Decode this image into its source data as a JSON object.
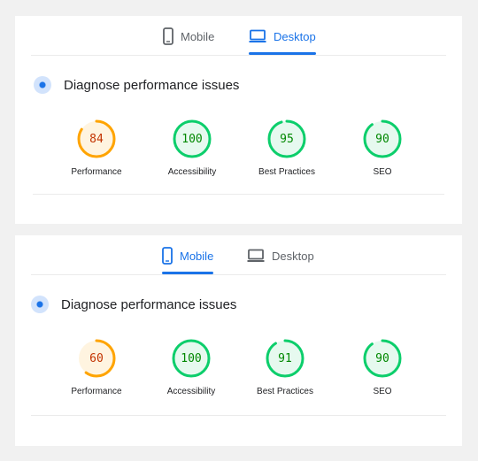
{
  "colors": {
    "accent": "#1a73e8",
    "pass": "#0cce6b",
    "average": "#ffa400",
    "pass_text": "#008800",
    "average_text": "#c33300"
  },
  "panels": [
    {
      "active_tab": "desktop",
      "tabs": {
        "mobile": {
          "label": "Mobile",
          "icon": "phone-icon"
        },
        "desktop": {
          "label": "Desktop",
          "icon": "laptop-icon"
        }
      },
      "diagnose": {
        "label": "Diagnose performance issues",
        "icon": "diagnose-icon"
      },
      "scores": [
        {
          "value": "84",
          "score": 84,
          "rating": "average",
          "label": "Performance"
        },
        {
          "value": "100",
          "score": 100,
          "rating": "pass",
          "label": "Accessibility"
        },
        {
          "value": "95",
          "score": 95,
          "rating": "pass",
          "label": "Best Practices"
        },
        {
          "value": "90",
          "score": 90,
          "rating": "pass",
          "label": "SEO"
        }
      ]
    },
    {
      "active_tab": "mobile",
      "tabs": {
        "mobile": {
          "label": "Mobile",
          "icon": "phone-icon"
        },
        "desktop": {
          "label": "Desktop",
          "icon": "laptop-icon"
        }
      },
      "diagnose": {
        "label": "Diagnose performance issues",
        "icon": "diagnose-icon"
      },
      "scores": [
        {
          "value": "60",
          "score": 60,
          "rating": "average",
          "label": "Performance"
        },
        {
          "value": "100",
          "score": 100,
          "rating": "pass",
          "label": "Accessibility"
        },
        {
          "value": "91",
          "score": 91,
          "rating": "pass",
          "label": "Best Practices"
        },
        {
          "value": "90",
          "score": 90,
          "rating": "pass",
          "label": "SEO"
        }
      ]
    }
  ]
}
